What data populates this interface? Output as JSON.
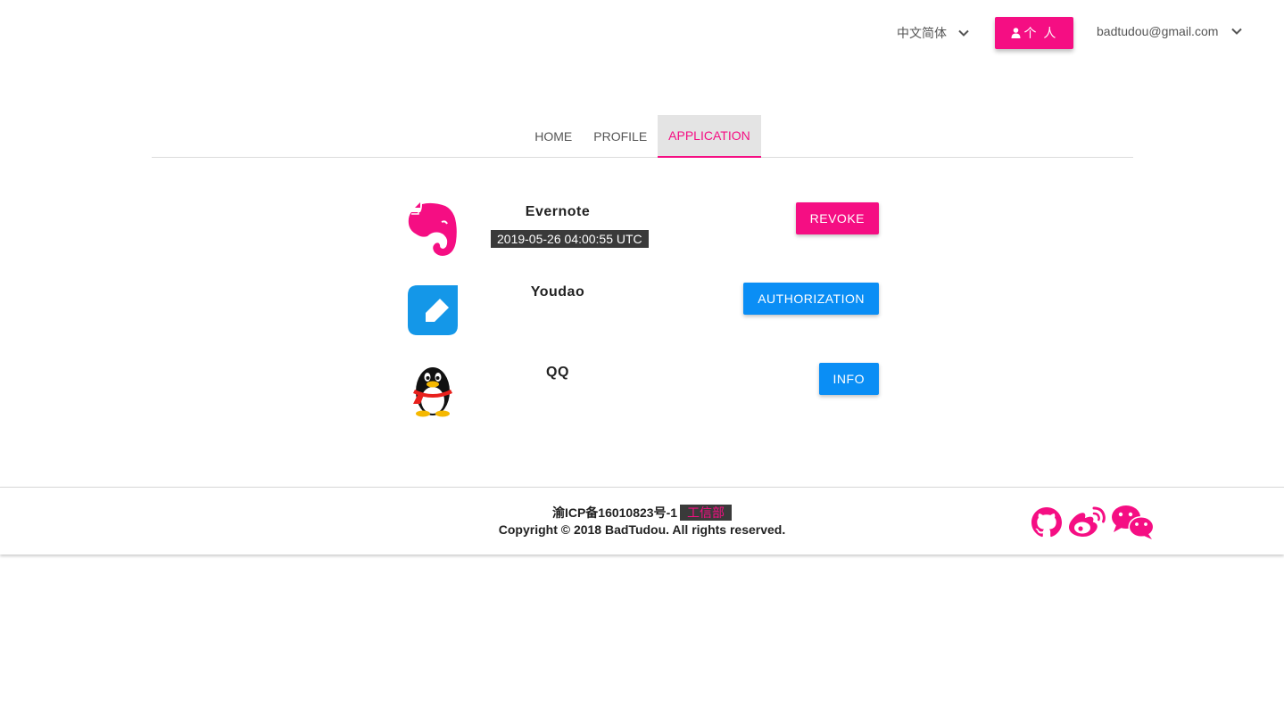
{
  "header": {
    "language": "中文简体",
    "profile_button": "个 人",
    "user_email": "badtudou@gmail.com"
  },
  "tabs": [
    {
      "label": "HOME",
      "active": false
    },
    {
      "label": "PROFILE",
      "active": false
    },
    {
      "label": "APPLICATION",
      "active": true
    }
  ],
  "apps": [
    {
      "name": "Evernote",
      "time": "2019-05-26 04:00:55 UTC",
      "button": "REVOKE",
      "icon": "evernote-icon"
    },
    {
      "name": "Youdao",
      "button": "AUTHORIZATION",
      "icon": "youdao-icon"
    },
    {
      "name": "QQ",
      "button": "INFO",
      "icon": "qq-icon"
    }
  ],
  "footer": {
    "icp": "渝ICP备16010823号-1",
    "icp_badge": "工信部",
    "copyright": "Copyright © 2018 BadTudou. All rights reserved.",
    "social_icons": [
      "github-icon",
      "weibo-icon",
      "wechat-icon"
    ]
  },
  "colors": {
    "accent_pink": "#f50e83",
    "accent_blue": "#0a8ef5",
    "badge_bg": "#3a3a3a"
  }
}
